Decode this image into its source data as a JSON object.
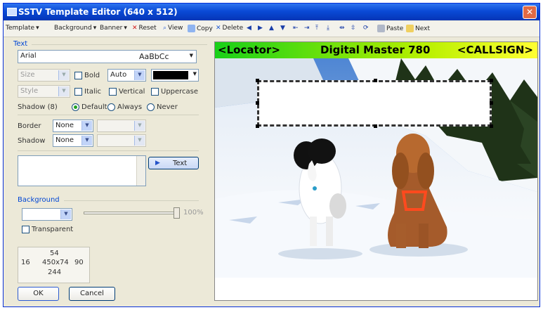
{
  "window": {
    "title": "SSTV Template Editor (640 x 512)",
    "close_glyph": "✕"
  },
  "toolbar": {
    "template_label": "Template",
    "background_label": "Background",
    "banner_label": "Banner",
    "reset_label": "Reset",
    "view_label": "View",
    "copy_label": "Copy",
    "delete_label": "Delete",
    "paste_label": "Paste",
    "next_label": "Next"
  },
  "text_group": {
    "title": "Text",
    "font_name": "Arial",
    "font_sample": "AaBbCc",
    "size_placeholder": "Size",
    "style_placeholder": "Style",
    "bold_label": "Bold",
    "italic_label": "Italic",
    "vertical_label": "Vertical",
    "uppercase_label": "Uppercase",
    "auto_value": "Auto",
    "shadow_label": "Shadow (8)",
    "default_label": "Default",
    "always_label": "Always",
    "never_label": "Never",
    "border_label": "Border",
    "border_value": "None",
    "shadow2_label": "Shadow",
    "shadow2_value": "None",
    "text_button": "Text"
  },
  "background_group": {
    "title": "Background",
    "transparent_label": "Transparent",
    "slider_value": "100%"
  },
  "position": {
    "top": "54",
    "left": "16",
    "center": "450x74",
    "right": "90",
    "bottom": "244"
  },
  "dialog": {
    "ok_label": "OK",
    "cancel_label": "Cancel"
  },
  "banner": {
    "left": "<Locator>",
    "center": "Digital Master 780",
    "right": "<CALLSIGN>"
  },
  "colors": {
    "font_color": "#000000",
    "banner_green": "#18d018",
    "banner_yellow": "#ffff33"
  }
}
